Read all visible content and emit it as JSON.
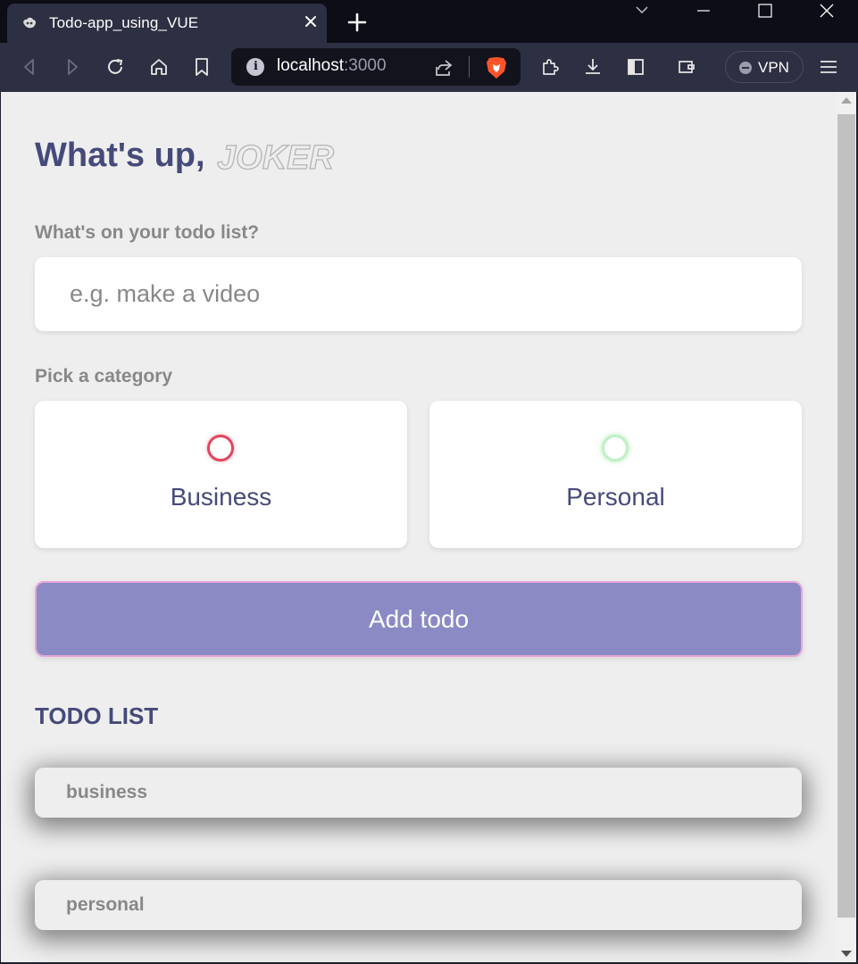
{
  "browser": {
    "tab_title": "Todo-app_using_VUE",
    "url_host": "localhost",
    "url_port": ":3000",
    "vpn_label": "VPN"
  },
  "app": {
    "greeting": "What's up,",
    "user_name": "JOKER",
    "todo_label": "What's on your todo list?",
    "todo_placeholder": "e.g. make a video",
    "category_label": "Pick a category",
    "categories": [
      {
        "label": "Business",
        "color": "#e0475c"
      },
      {
        "label": "Personal",
        "color": "#bff0c4"
      }
    ],
    "add_button": "Add todo",
    "list_title": "TODO LIST",
    "todos": [
      {
        "text": "business"
      },
      {
        "text": "personal"
      }
    ]
  },
  "colors": {
    "primary_text": "#464a7a",
    "accent_button": "#8b8ac5",
    "muted_text": "#888888",
    "page_bg": "#eeeeee"
  }
}
